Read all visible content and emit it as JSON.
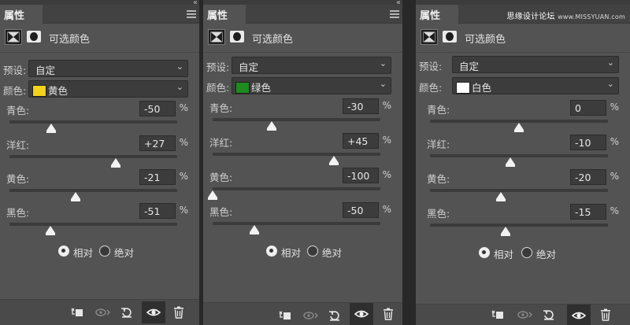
{
  "watermark": {
    "main": "思缘设计论坛",
    "sub": "www.MISSYUAN.com"
  },
  "panels": [
    {
      "tab": "属性",
      "title": "可选颜色",
      "preset_label": "预设:",
      "preset_value": "自定",
      "color_label": "颜色:",
      "color_value": "黄色",
      "color_swatch": "#f2d21a",
      "sliders": [
        {
          "label": "青色:",
          "value": "-50",
          "unit": "%",
          "percent": -50
        },
        {
          "label": "洋红:",
          "value": "+27",
          "unit": "%",
          "percent": 27
        },
        {
          "label": "黄色:",
          "value": "-21",
          "unit": "%",
          "percent": -21
        },
        {
          "label": "黑色:",
          "value": "-51",
          "unit": "%",
          "percent": -51
        }
      ],
      "method_relative": "相对",
      "method_absolute": "绝对",
      "method_selected": "relative"
    },
    {
      "tab": "属性",
      "title": "可选颜色",
      "preset_label": "预设:",
      "preset_value": "自定",
      "color_label": "颜色:",
      "color_value": "绿色",
      "color_swatch": "#1f8a1f",
      "sliders": [
        {
          "label": "青色:",
          "value": "-30",
          "unit": "%",
          "percent": -30
        },
        {
          "label": "洋红:",
          "value": "+45",
          "unit": "%",
          "percent": 45
        },
        {
          "label": "黄色:",
          "value": "-100",
          "unit": "%",
          "percent": -100
        },
        {
          "label": "黑色:",
          "value": "-50",
          "unit": "%",
          "percent": -50
        }
      ],
      "method_relative": "相对",
      "method_absolute": "绝对",
      "method_selected": "relative"
    },
    {
      "tab": "属性",
      "title": "可选颜色",
      "preset_label": "预设:",
      "preset_value": "自定",
      "color_label": "颜色:",
      "color_value": "白色",
      "color_swatch": "#ffffff",
      "sliders": [
        {
          "label": "青色:",
          "value": "0",
          "unit": "%",
          "percent": 0
        },
        {
          "label": "洋红:",
          "value": "-10",
          "unit": "%",
          "percent": -10
        },
        {
          "label": "黄色:",
          "value": "-20",
          "unit": "%",
          "percent": -20
        },
        {
          "label": "黑色:",
          "value": "-15",
          "unit": "%",
          "percent": -15
        }
      ],
      "method_relative": "相对",
      "method_absolute": "绝对",
      "method_selected": "relative"
    }
  ]
}
